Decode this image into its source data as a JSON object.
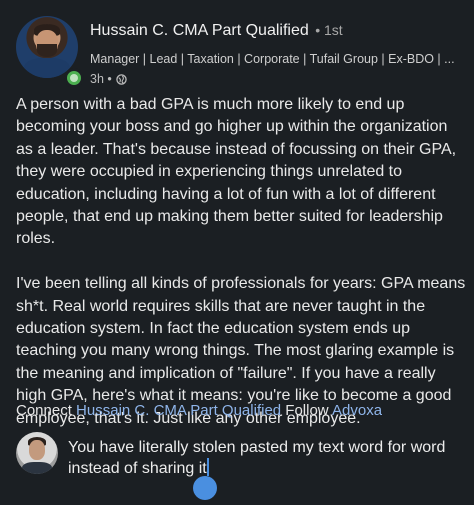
{
  "post": {
    "author_name": "Hussain C. CMA Part Qualified",
    "connection_degree": "• 1st",
    "headline": "Manager | Lead | Taxation | Corporate | Tufail Group | Ex-BDO | ...",
    "time": "3h •",
    "paragraphs": [
      "A person with a bad GPA is much more likely to end up becoming your boss and go higher up within the organization as a leader. That's because instead of focussing on their GPA, they were occupied in experiencing things unrelated to education, including having a lot of fun with a lot of different people, that end up making them better suited for leadership roles.",
      "I've been telling all kinds of professionals for years: GPA means sh*t. Real world requires skills that are never taught in the education system. In fact the education system ends up teaching you many wrong things. The most glaring example is the meaning and implication of \"failure\". If you have a really high GPA, here's what it means: you're like to become a good employee, that's it. Just like any other employee."
    ],
    "connect_prefix": "Connect",
    "connect_name": "Hussain C. CMA Part Qualified",
    "follow_prefix": "Follow",
    "follow_name": "Advoxa"
  },
  "comment": {
    "text": "You have literally stolen pasted my text word for word instead of sharing it"
  },
  "colors": {
    "background": "#1b1f23",
    "link": "#8fb5ea",
    "accent": "#4a8fe0",
    "online": "#4caf50"
  },
  "icons": [
    "globe-icon",
    "online-status-icon"
  ]
}
